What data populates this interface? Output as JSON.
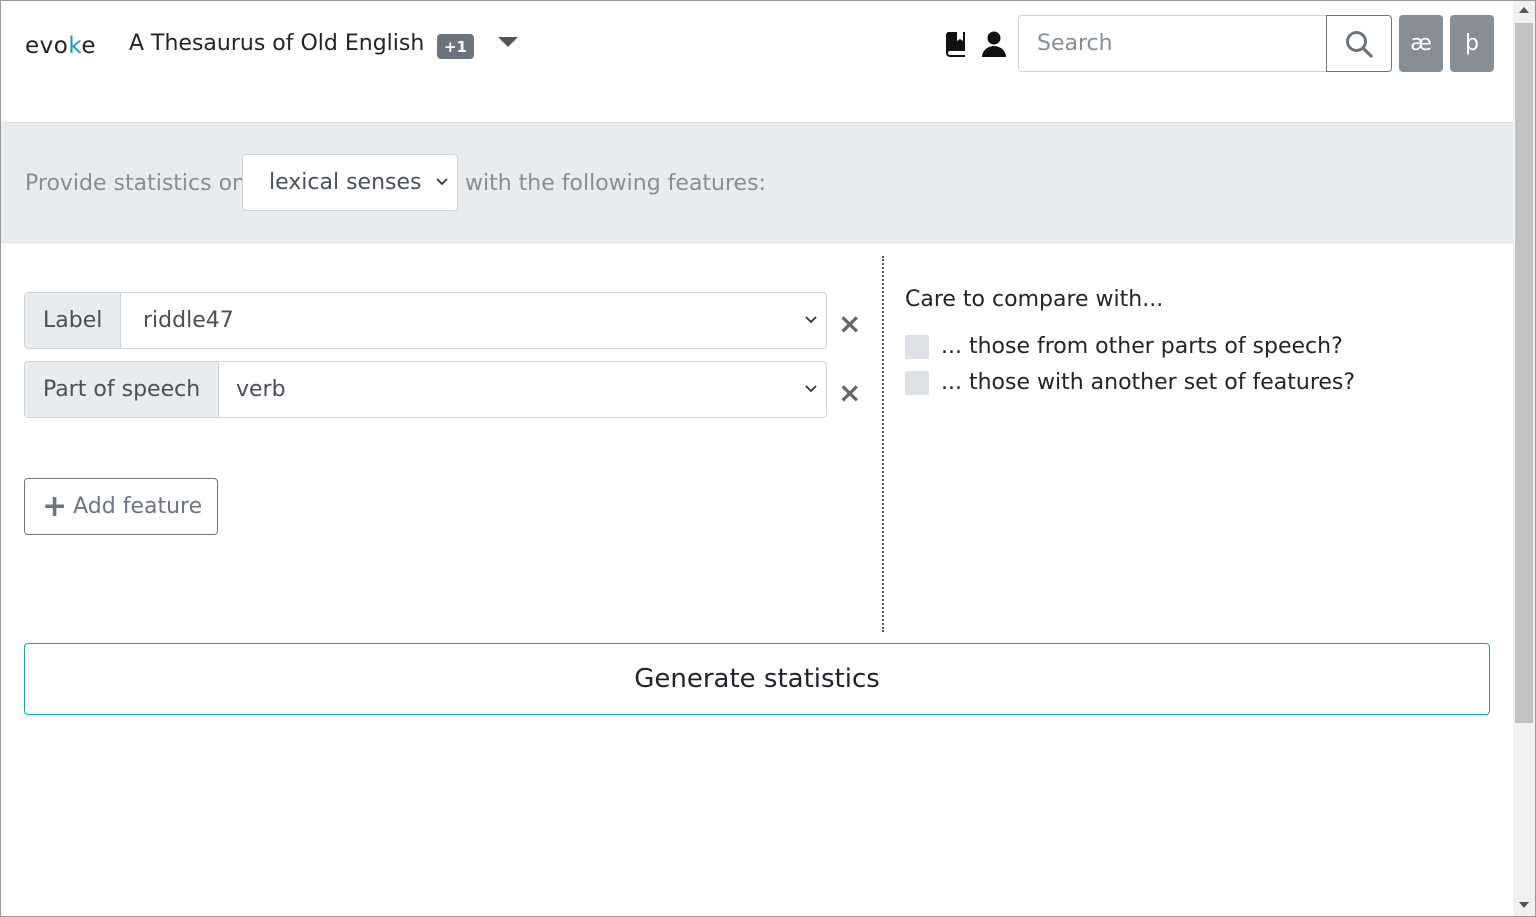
{
  "header": {
    "logo_text_1": "evo",
    "logo_text_k": "k",
    "logo_text_2": "e",
    "app_title": "A Thesaurus of Old English",
    "badge": "+1",
    "search": {
      "placeholder": "Search",
      "value": ""
    },
    "char_buttons": [
      "æ",
      "þ"
    ],
    "icons": [
      "book-icon",
      "user-icon",
      "search-icon",
      "caret-down-icon"
    ]
  },
  "band": {
    "prefix": "Provide statistics on",
    "select_value": "lexical senses",
    "suffix": "with the following features:"
  },
  "features": [
    {
      "label": "Label",
      "value": "riddle47"
    },
    {
      "label": "Part of speech",
      "value": "verb"
    }
  ],
  "add_feature_label": "Add feature",
  "compare": {
    "title": "Care to compare with...",
    "options": [
      "... those from other parts of speech?",
      "... those with another set of features?"
    ]
  },
  "generate_label": "Generate statistics",
  "colors": {
    "accent": "#17a2b8",
    "band_bg": "#e9ecef",
    "secondary": "#6c757d",
    "logo_accent": "#1f9bb0"
  }
}
